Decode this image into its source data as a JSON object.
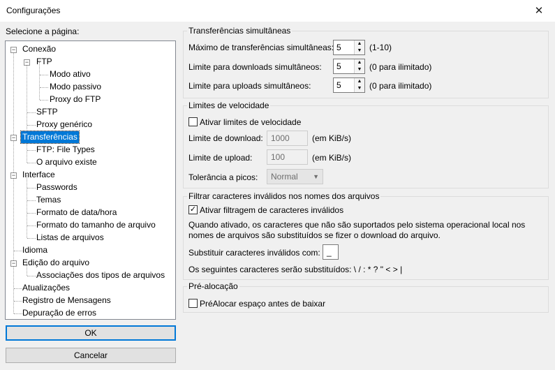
{
  "window": {
    "title": "Configurações",
    "close_label": "✕"
  },
  "sidebar": {
    "heading": "Selecione a página:",
    "tree": [
      "Conexão",
      "FTP",
      "Modo ativo",
      "Modo passivo",
      "Proxy do FTP",
      "SFTP",
      "Proxy genérico",
      "Transferências",
      "FTP: File Types",
      "O arquivo existe",
      "Interface",
      "Passwords",
      "Temas",
      "Formato de data/hora",
      "Formato do tamanho de arquivo",
      "Listas de arquivos",
      "Idioma",
      "Edição do arquivo",
      "Associações dos tipos de arquivos",
      "Atualizações",
      "Registro de Mensagens",
      "Depuração de erros"
    ],
    "selected": "Transferências",
    "ok_label": "OK",
    "cancel_label": "Cancelar"
  },
  "simultaneous": {
    "legend": "Transferências simultâneas",
    "max_label": "Máximo de transferências simultâneas:",
    "max_value": "5",
    "max_hint": "(1-10)",
    "dl_label": "Limite para downloads simultâneos:",
    "dl_value": "5",
    "dl_hint": "(0 para ilimitado)",
    "ul_label": "Limite para uploads simultâneos:",
    "ul_value": "5",
    "ul_hint": "(0 para ilimitado)"
  },
  "speed": {
    "legend": "Limites de velocidade",
    "enable_label": "Ativar limites de velocidade",
    "enable_checked": false,
    "dl_label": "Limite de download:",
    "dl_value": "1000",
    "dl_unit": "(em KiB/s)",
    "ul_label": "Limite de upload:",
    "ul_value": "100",
    "ul_unit": "(em KiB/s)",
    "burst_label": "Tolerância a picos:",
    "burst_value": "Normal"
  },
  "filter": {
    "legend": "Filtrar caracteres inválidos nos nomes dos arquivos",
    "enable_label": "Ativar filtragem de caracteres inválidos",
    "enable_checked": true,
    "desc_line1": "Quando ativado, os caracteres que não são suportados pelo sistema operacional local nos",
    "desc_line2": "nomes de arquivos são substituídos se fizer o download do arquivo.",
    "replace_label": "Substituir caracteres inválidos com:",
    "replace_value": "_",
    "following": "Os seguintes caracteres serão substituídos: \\ / : * ? \" < > |"
  },
  "prealloc": {
    "legend": "Pré-alocação",
    "label": "PréAlocar espaço antes de baixar",
    "checked": false
  }
}
